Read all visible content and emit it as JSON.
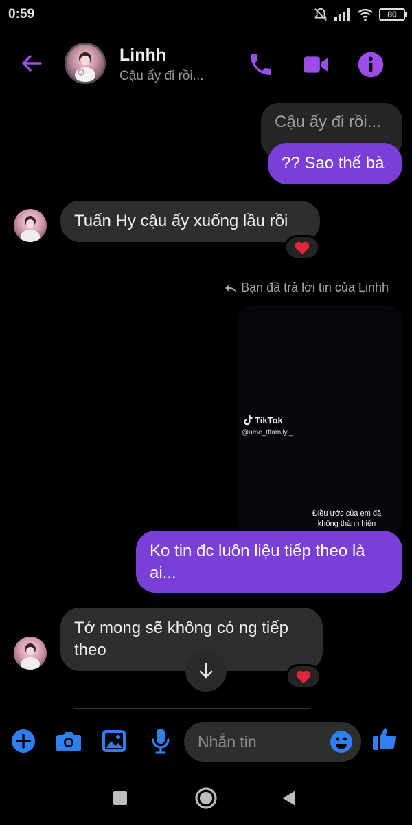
{
  "status_bar": {
    "time": "0:59",
    "battery": "80"
  },
  "header": {
    "contact_name": "Linhh",
    "contact_status": "Cậu ấy đi rồi..."
  },
  "messages": {
    "m1_text": "Cậu ấy đi rồi...",
    "m2_text": "?? Sao thế bà",
    "m3_text": "Tuấn Hy cậu ấy xuống lầu rồi",
    "reply_note": "Bạn đã trả lời tin của Linhh",
    "tiktok_brand": "TikTok",
    "tiktok_user": "@ume_tffamily._",
    "video_caption": "Điều ước của em đã không thành hiện",
    "m4_text": "Ko tin đc luôn liệu tiếp theo là ai...",
    "m5_text": "Tớ mong sẽ không có ng tiếp theo"
  },
  "composer": {
    "placeholder": "Nhắn tin"
  },
  "colors": {
    "accent": "#7a3fd6",
    "icon_purple": "#9b4dea",
    "icon_blue": "#2f7ff0",
    "reaction_heart": "#e2263b"
  },
  "icons": [
    "back-arrow-icon",
    "phone-icon",
    "video-call-icon",
    "info-icon",
    "reply-icon",
    "heart-icon",
    "arrow-down-icon",
    "plus-icon",
    "camera-icon",
    "image-icon",
    "microphone-icon",
    "emoji-icon",
    "thumbs-up-icon"
  ]
}
